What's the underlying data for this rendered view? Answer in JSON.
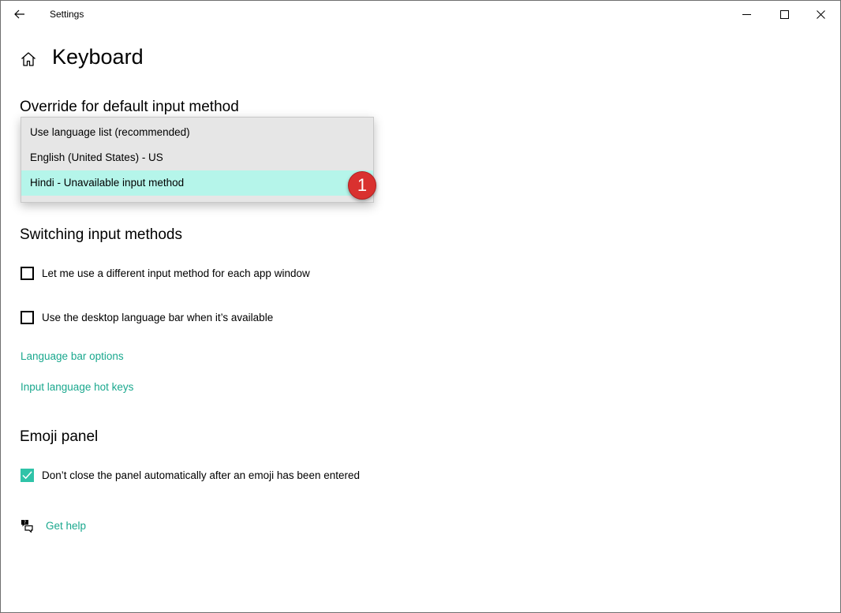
{
  "window": {
    "app_title": "Settings"
  },
  "header": {
    "title": "Keyboard"
  },
  "override": {
    "section_title": "Override for default input method",
    "options": [
      "Use language list (recommended)",
      "English (United States) - US",
      "Hindi - Unavailable input method"
    ],
    "selected_option": "Hindi - Unavailable input method"
  },
  "annotation": {
    "badge": "1",
    "badge_color": "#d9312f"
  },
  "switching": {
    "section_title": "Switching input methods",
    "per_app_checkbox": {
      "label": "Let me use a different input method for each app window",
      "checked": false
    },
    "language_bar_checkbox": {
      "label": "Use the desktop language bar when it’s available",
      "checked": false
    },
    "language_bar_options_link": "Language bar options",
    "hot_keys_link": "Input language hot keys"
  },
  "emoji": {
    "section_title": "Emoji panel",
    "keep_open_checkbox": {
      "label": "Don’t close the panel automatically after an emoji has been entered",
      "checked": true
    }
  },
  "help": {
    "label": "Get help"
  },
  "colors": {
    "accent": "#1aa88e",
    "checkbox_checked": "#2fc3a8",
    "dropdown_selected": "#b5f5ea"
  },
  "icons": {
    "back": "back-arrow-icon",
    "home": "home-icon",
    "minimize": "minimize-icon",
    "maximize": "maximize-icon",
    "close": "close-icon",
    "help": "help-chat-icon",
    "check": "checkmark-icon"
  }
}
